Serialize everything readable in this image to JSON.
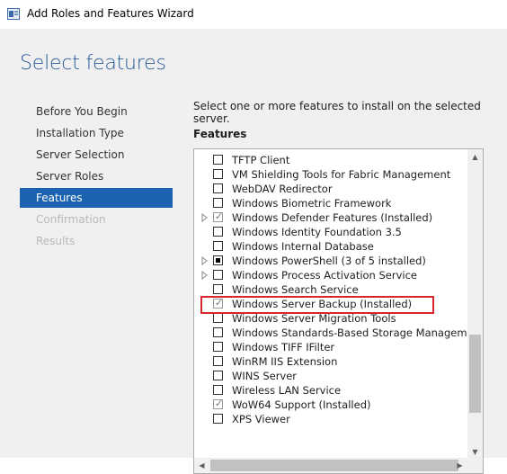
{
  "window": {
    "title": "Add Roles and Features Wizard"
  },
  "heading": "Select features",
  "nav": [
    {
      "label": "Before You Begin",
      "state": "normal"
    },
    {
      "label": "Installation Type",
      "state": "normal"
    },
    {
      "label": "Server Selection",
      "state": "normal"
    },
    {
      "label": "Server Roles",
      "state": "normal"
    },
    {
      "label": "Features",
      "state": "active"
    },
    {
      "label": "Confirmation",
      "state": "disabled"
    },
    {
      "label": "Results",
      "state": "disabled"
    }
  ],
  "instruction": "Select one or more features to install on the selected server.",
  "features_label": "Features",
  "features": [
    {
      "label": "TFTP Client",
      "check": "unchecked",
      "expandable": false
    },
    {
      "label": "VM Shielding Tools for Fabric Management",
      "check": "unchecked",
      "expandable": false
    },
    {
      "label": "WebDAV Redirector",
      "check": "unchecked",
      "expandable": false
    },
    {
      "label": "Windows Biometric Framework",
      "check": "unchecked",
      "expandable": false
    },
    {
      "label": "Windows Defender Features (Installed)",
      "check": "checked",
      "expandable": true
    },
    {
      "label": "Windows Identity Foundation 3.5",
      "check": "unchecked",
      "expandable": false
    },
    {
      "label": "Windows Internal Database",
      "check": "unchecked",
      "expandable": false
    },
    {
      "label": "Windows PowerShell (3 of 5 installed)",
      "check": "partial",
      "expandable": true
    },
    {
      "label": "Windows Process Activation Service",
      "check": "unchecked",
      "expandable": true
    },
    {
      "label": "Windows Search Service",
      "check": "unchecked",
      "expandable": false
    },
    {
      "label": "Windows Server Backup (Installed)",
      "check": "checked",
      "expandable": false
    },
    {
      "label": "Windows Server Migration Tools",
      "check": "unchecked",
      "expandable": false
    },
    {
      "label": "Windows Standards-Based Storage Management",
      "check": "unchecked",
      "expandable": false
    },
    {
      "label": "Windows TIFF IFilter",
      "check": "unchecked",
      "expandable": false
    },
    {
      "label": "WinRM IIS Extension",
      "check": "unchecked",
      "expandable": false
    },
    {
      "label": "WINS Server",
      "check": "unchecked",
      "expandable": false
    },
    {
      "label": "Wireless LAN Service",
      "check": "unchecked",
      "expandable": false
    },
    {
      "label": "WoW64 Support (Installed)",
      "check": "checked",
      "expandable": false
    },
    {
      "label": "XPS Viewer",
      "check": "unchecked",
      "expandable": false
    }
  ],
  "icons": {
    "app": "server-manager-icon",
    "expander": "expand-triangle-icon",
    "check": "checkmark-icon"
  },
  "colors": {
    "accent": "#1b62b0",
    "heading": "#2a5a9a",
    "highlight": "#d9262e"
  }
}
